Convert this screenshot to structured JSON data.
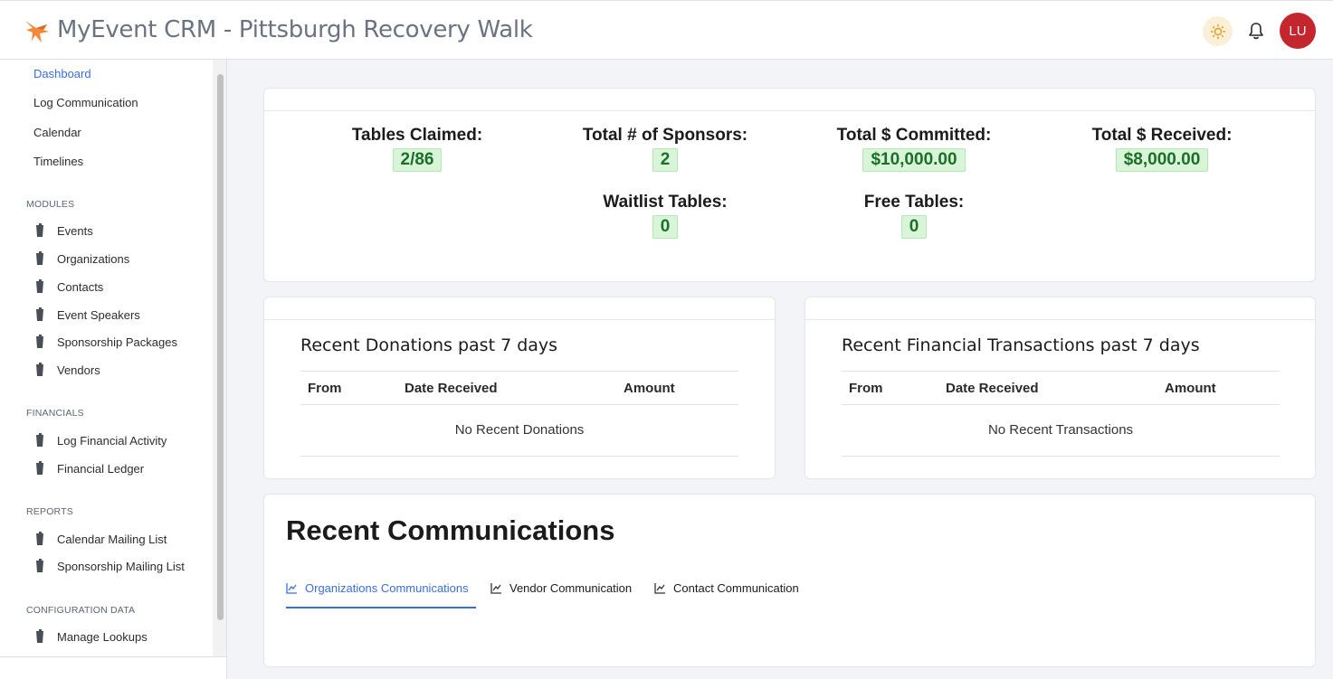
{
  "header": {
    "title": "MyEvent CRM - Pittsburgh Recovery Walk",
    "avatar_initials": "LU",
    "accent": "#3b6fd8",
    "avatar_color": "#c3262c"
  },
  "sidebar": {
    "top_items": [
      {
        "label": "Dashboard",
        "active": true
      },
      {
        "label": "Log Communication"
      },
      {
        "label": "Calendar"
      },
      {
        "label": "Timelines"
      }
    ],
    "sections": [
      {
        "title": "MODULES",
        "items": [
          "Events",
          "Organizations",
          "Contacts",
          "Event Speakers",
          "Sponsorship Packages",
          "Vendors"
        ]
      },
      {
        "title": "FINANCIALS",
        "items": [
          "Log Financial Activity",
          "Financial Ledger"
        ]
      },
      {
        "title": "REPORTS",
        "items": [
          "Calendar Mailing List",
          "Sponsorship Mailing List"
        ]
      },
      {
        "title": "CONFIGURATION DATA",
        "items": [
          "Manage Lookups"
        ]
      }
    ]
  },
  "stats": {
    "tables_claimed": {
      "label": "Tables Claimed:",
      "value": "2/86"
    },
    "total_sponsors": {
      "label": "Total # of Sponsors:",
      "value": "2"
    },
    "total_committed": {
      "label": "Total $ Committed:",
      "value": "$10,000.00"
    },
    "total_received": {
      "label": "Total $ Received:",
      "value": "$8,000.00"
    },
    "waitlist_tables": {
      "label": "Waitlist Tables:",
      "value": "0"
    },
    "free_tables": {
      "label": "Free Tables:",
      "value": "0"
    }
  },
  "donations": {
    "title": "Recent Donations past 7 days",
    "columns": [
      "From",
      "Date Received",
      "Amount"
    ],
    "empty": "No Recent Donations"
  },
  "transactions": {
    "title": "Recent Financial Transactions past 7 days",
    "columns": [
      "From",
      "Date Received",
      "Amount"
    ],
    "empty": "No Recent Transactions"
  },
  "communications": {
    "title": "Recent Communications",
    "tabs": [
      {
        "label": "Organizations Communications",
        "active": true
      },
      {
        "label": "Vendor Communication"
      },
      {
        "label": "Contact Communication"
      }
    ]
  }
}
